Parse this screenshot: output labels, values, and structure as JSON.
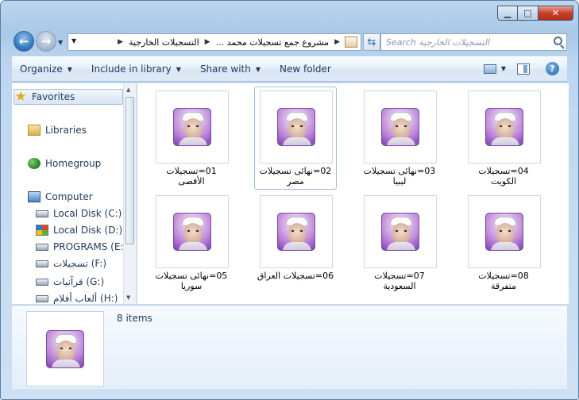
{
  "window": {
    "controls": {
      "minimize": "▁",
      "maximize": "□",
      "close": "✕"
    }
  },
  "address_bar": {
    "crumbs": [
      "مشروع جمع تسجيلات محمد ...",
      "التسجيلات الخارجية"
    ],
    "separator": "▶"
  },
  "search": {
    "placeholder": "Search التسجيلات الخارجية"
  },
  "toolbar": {
    "organize": "Organize",
    "include_in_library": "Include in library",
    "share_with": "Share with",
    "new_folder": "New folder"
  },
  "nav": {
    "favorites": "Favorites",
    "libraries": "Libraries",
    "homegroup": "Homegroup",
    "computer": "Computer",
    "drives": [
      "Local Disk (C:)",
      "Local Disk (D:)",
      "PROGRAMS (E:)",
      "تسجيلات (F:)",
      "قرآنيات (G:)",
      "ألعاب أفلام (H:)"
    ]
  },
  "items": [
    "01=تسجيلات الأقصى",
    "02=نهائى تسجيلات مصر",
    "03=نهائى تسجيلات ليبيا",
    "04=تسجيلات الكويت",
    "05=نهائى تسجيلات سوريا",
    "06=تسجيلات العراق",
    "07=تسجيلات السعودية",
    "08=تسجيلات متفرقة"
  ],
  "details": {
    "count": "8 items"
  }
}
